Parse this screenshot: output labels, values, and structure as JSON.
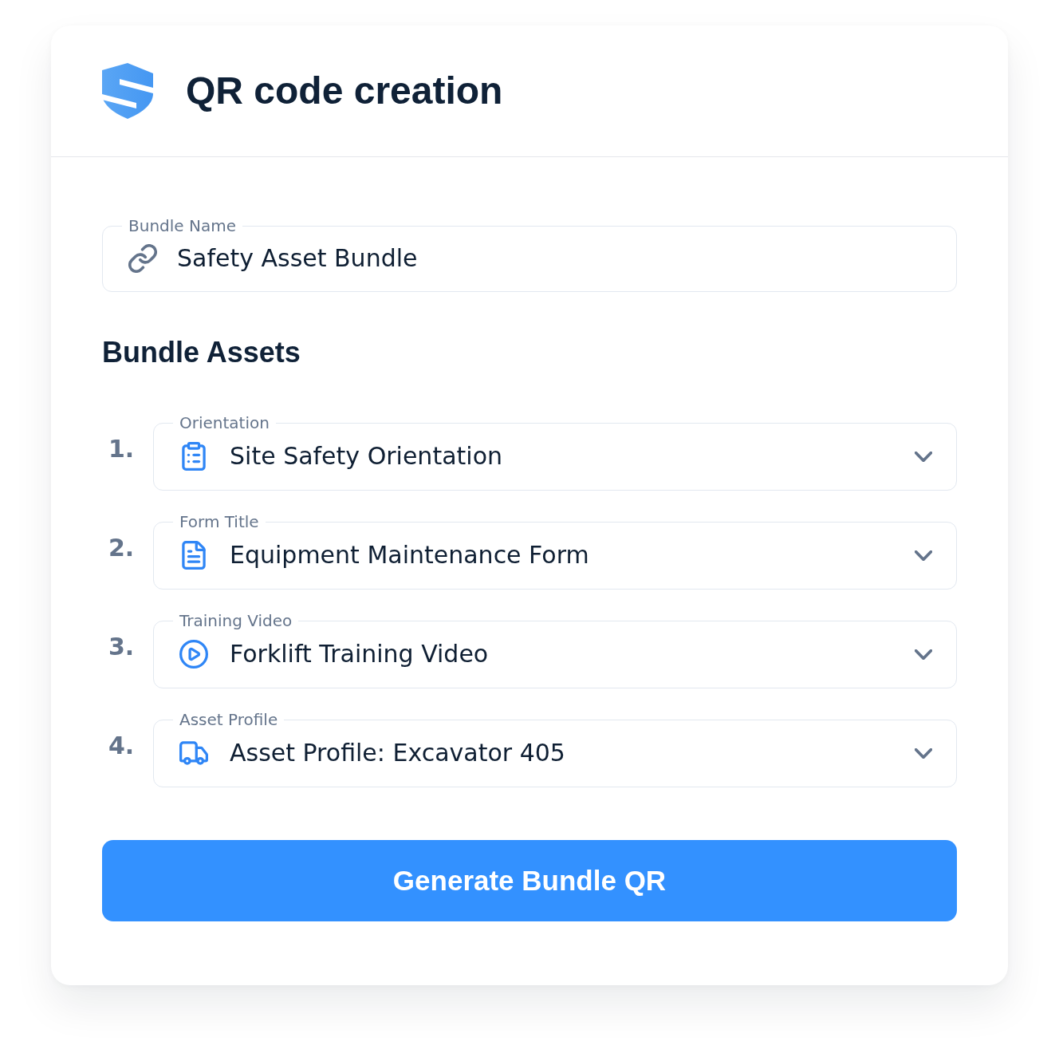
{
  "header": {
    "title": "QR code creation"
  },
  "bundle_name": {
    "label": "Bundle Name",
    "value": "Safety Asset Bundle"
  },
  "assets_section": {
    "heading": "Bundle Assets",
    "assets": [
      {
        "number": "1.",
        "label": "Orientation",
        "value": "Site Safety Orientation",
        "kind": "clipboard"
      },
      {
        "number": "2.",
        "label": "Form Title",
        "value": "Equipment Maintenance Form",
        "kind": "document"
      },
      {
        "number": "3.",
        "label": "Training Video",
        "value": "Forklift Training Video",
        "kind": "video"
      },
      {
        "number": "4.",
        "label": "Asset Profile",
        "value": "Asset Profile: Excavator 405",
        "kind": "vehicle"
      }
    ]
  },
  "generate_button": {
    "label": "Generate Bundle QR"
  }
}
